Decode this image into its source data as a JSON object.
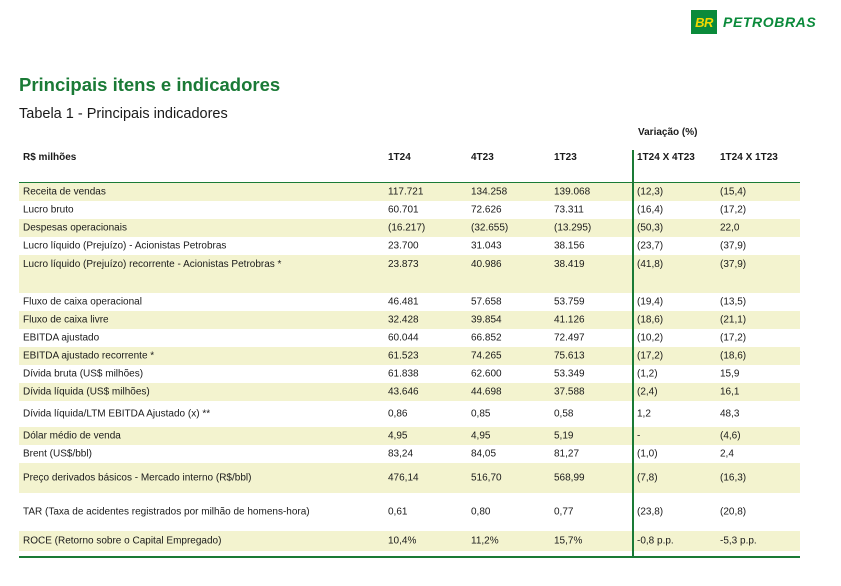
{
  "brand": {
    "mark": "BR",
    "name": "PETROBRAS",
    "color": "#0a8a3a"
  },
  "section_title": "Principais itens e indicadores",
  "table_title": "Tabela 1 - Principais indicadores",
  "variation_header": "Variação (%)",
  "columns": [
    "R$ milhões",
    "1T24",
    "4T23",
    "1T23",
    "1T24 X 4T23",
    "1T24 X 1T23"
  ],
  "rows": [
    {
      "label": "Receita de vendas",
      "v": [
        "117.721",
        "134.258",
        "139.068",
        "(12,3)",
        "(15,4)"
      ],
      "shaded": true
    },
    {
      "label": "Lucro bruto",
      "v": [
        "60.701",
        "72.626",
        "73.311",
        "(16,4)",
        "(17,2)"
      ],
      "shaded": false
    },
    {
      "label": "Despesas operacionais",
      "v": [
        "(16.217)",
        "(32.655)",
        "(13.295)",
        "(50,3)",
        "22,0"
      ],
      "shaded": true
    },
    {
      "label": "Lucro líquido (Prejuízo) - Acionistas Petrobras",
      "v": [
        "23.700",
        "31.043",
        "38.156",
        "(23,7)",
        "(37,9)"
      ],
      "shaded": false
    },
    {
      "label": "Lucro líquido (Prejuízo) recorrente - Acionistas Petrobras *",
      "v": [
        "23.873",
        "40.986",
        "38.419",
        "(41,8)",
        "(37,9)"
      ],
      "shaded": true
    },
    {
      "label": "Fluxo de caixa operacional",
      "v": [
        "46.481",
        "57.658",
        "53.759",
        "(19,4)",
        "(13,5)"
      ],
      "shaded": false
    },
    {
      "label": "Fluxo de caixa livre",
      "v": [
        "32.428",
        "39.854",
        "41.126",
        "(18,6)",
        "(21,1)"
      ],
      "shaded": true
    },
    {
      "label": "EBITDA ajustado",
      "v": [
        "60.044",
        "66.852",
        "72.497",
        "(10,2)",
        "(17,2)"
      ],
      "shaded": false
    },
    {
      "label": "EBITDA ajustado recorrente *",
      "v": [
        "61.523",
        "74.265",
        "75.613",
        "(17,2)",
        "(18,6)"
      ],
      "shaded": true
    },
    {
      "label": "Dívida bruta (US$ milhões)",
      "v": [
        "61.838",
        "62.600",
        "53.349",
        "(1,2)",
        "15,9"
      ],
      "shaded": false
    },
    {
      "label": "Dívida líquida (US$ milhões)",
      "v": [
        "43.646",
        "44.698",
        "37.588",
        "(2,4)",
        "16,1"
      ],
      "shaded": true
    },
    {
      "label": "Dívida líquida/LTM EBITDA Ajustado (x) **",
      "v": [
        "0,86",
        "0,85",
        "0,58",
        "1,2",
        "48,3"
      ],
      "shaded": false
    },
    {
      "label": "Dólar médio de venda",
      "v": [
        "4,95",
        "4,95",
        "5,19",
        "-",
        "(4,6)"
      ],
      "shaded": true
    },
    {
      "label": "Brent (US$/bbl)",
      "v": [
        "83,24",
        "84,05",
        "81,27",
        "(1,0)",
        "2,4"
      ],
      "shaded": false
    },
    {
      "label": "Preço derivados básicos - Mercado interno (R$/bbl)",
      "v": [
        "476,14",
        "516,70",
        "568,99",
        "(7,8)",
        "(16,3)"
      ],
      "shaded": true
    },
    {
      "label": "TAR (Taxa de acidentes registrados por milhão de homens-hora)",
      "v": [
        "0,61",
        "0,80",
        "0,77",
        "(23,8)",
        "(20,8)"
      ],
      "shaded": false
    },
    {
      "label": "ROCE  (Retorno sobre o Capital Empregado)",
      "v": [
        "10,4%",
        "11,2%",
        "15,7%",
        "-0,8 p.p.",
        "-5,3 p.p."
      ],
      "shaded": true
    }
  ]
}
